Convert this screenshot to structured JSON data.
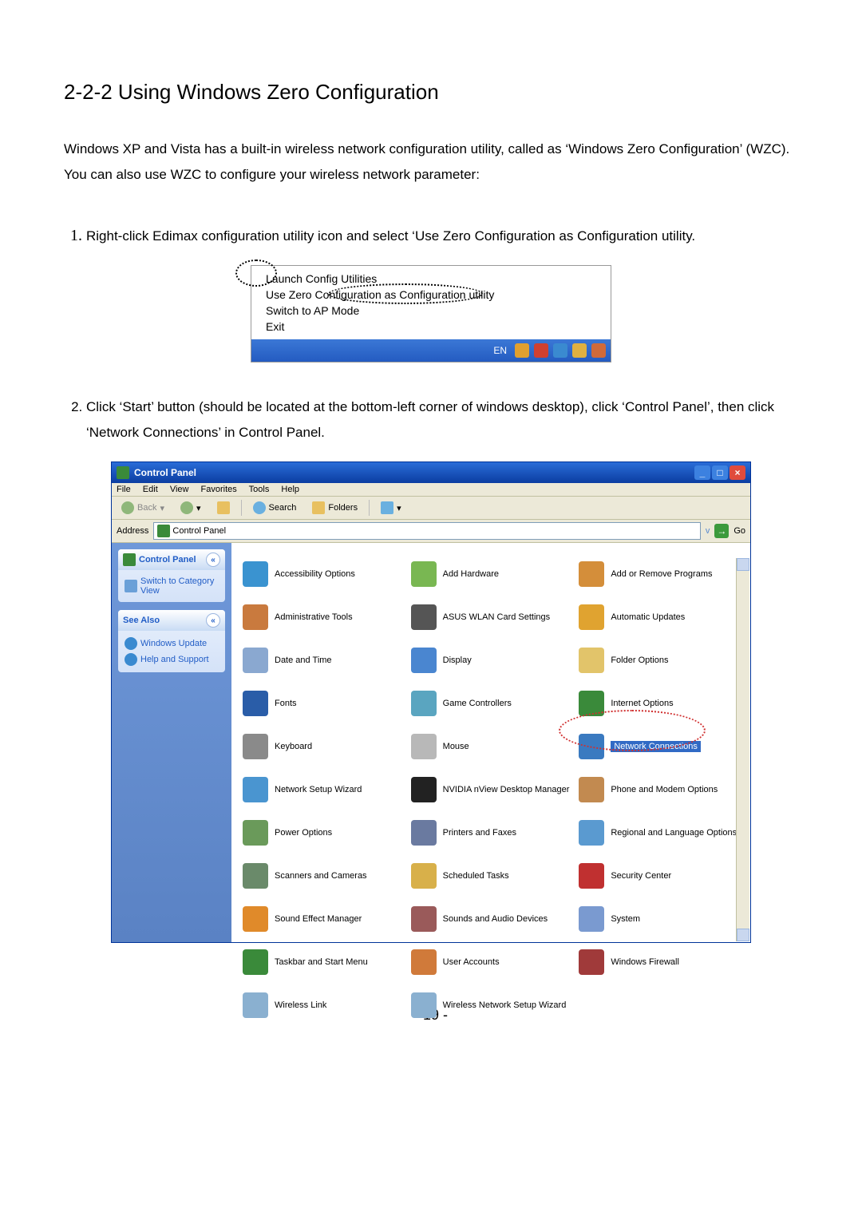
{
  "heading": "2-2-2 Using Windows Zero Configuration",
  "intro": "Windows XP and Vista has a built-in wireless network configuration utility, called as ‘Windows Zero Configuration’ (WZC). You can also use WZC to configure your wireless network parameter:",
  "step1": "Right-click Edimax configuration utility icon and select ‘Use Zero Configuration as Configuration utility.",
  "step2": "Click ‘Start’ button (should be located at the bottom-left corner of windows desktop), click ‘Control Panel’, then click ‘Network Connections’ in Control Panel.",
  "context_menu": {
    "items": [
      "Launch Config Utilities",
      "Use Zero Configuration as Configuration utility",
      "Switch to AP Mode",
      "Exit"
    ],
    "tray_lang": "EN"
  },
  "cp_window": {
    "title": "Control Panel",
    "menubar": [
      "File",
      "Edit",
      "View",
      "Favorites",
      "Tools",
      "Help"
    ],
    "toolbar": {
      "back": "Back",
      "search": "Search",
      "folders": "Folders"
    },
    "address_label": "Address",
    "address_value": "Control Panel",
    "go_label": "Go",
    "left": {
      "panel1_title": "Control Panel",
      "panel1_link": "Switch to Category View",
      "panel2_title": "See Also",
      "panel2_links": [
        "Windows Update",
        "Help and Support"
      ]
    },
    "items": [
      {
        "label": "Accessibility Options",
        "color": "#3a93d0"
      },
      {
        "label": "Add Hardware",
        "color": "#79b752"
      },
      {
        "label": "Add or Remove Programs",
        "color": "#d48e3a"
      },
      {
        "label": "Administrative Tools",
        "color": "#c97a3e"
      },
      {
        "label": "ASUS WLAN Card Settings",
        "color": "#555"
      },
      {
        "label": "Automatic Updates",
        "color": "#e0a330"
      },
      {
        "label": "Date and Time",
        "color": "#8aa8d0"
      },
      {
        "label": "Display",
        "color": "#4a86d0"
      },
      {
        "label": "Folder Options",
        "color": "#e2c46a"
      },
      {
        "label": "Fonts",
        "color": "#2a5da8"
      },
      {
        "label": "Game Controllers",
        "color": "#5aa5c0"
      },
      {
        "label": "Internet Options",
        "color": "#3a8a3a"
      },
      {
        "label": "Keyboard",
        "color": "#8a8a8a"
      },
      {
        "label": "Mouse",
        "color": "#b8b8b8"
      },
      {
        "label": "Network Connections",
        "color": "#3a7ac0",
        "highlight": true
      },
      {
        "label": "Network Setup Wizard",
        "color": "#4a95d0"
      },
      {
        "label": "NVIDIA nView Desktop Manager",
        "color": "#222"
      },
      {
        "label": "Phone and Modem Options",
        "color": "#c28a50"
      },
      {
        "label": "Power Options",
        "color": "#6a9a5a"
      },
      {
        "label": "Printers and Faxes",
        "color": "#6a7aa0"
      },
      {
        "label": "Regional and Language Options",
        "color": "#5a9ad0"
      },
      {
        "label": "Scanners and Cameras",
        "color": "#6a8a6a"
      },
      {
        "label": "Scheduled Tasks",
        "color": "#d8b04a"
      },
      {
        "label": "Security Center",
        "color": "#c03030"
      },
      {
        "label": "Sound Effect Manager",
        "color": "#e08a2a"
      },
      {
        "label": "Sounds and Audio Devices",
        "color": "#9a5a5a"
      },
      {
        "label": "System",
        "color": "#7a9ad0"
      },
      {
        "label": "Taskbar and Start Menu",
        "color": "#3a8a3a"
      },
      {
        "label": "User Accounts",
        "color": "#d07a3a"
      },
      {
        "label": "Windows Firewall",
        "color": "#a03a3a"
      },
      {
        "label": "Wireless Link",
        "color": "#8ab0d0"
      },
      {
        "label": "Wireless Network Setup Wizard",
        "color": "#8ab0d0"
      }
    ]
  },
  "page_number": "- 19 -"
}
